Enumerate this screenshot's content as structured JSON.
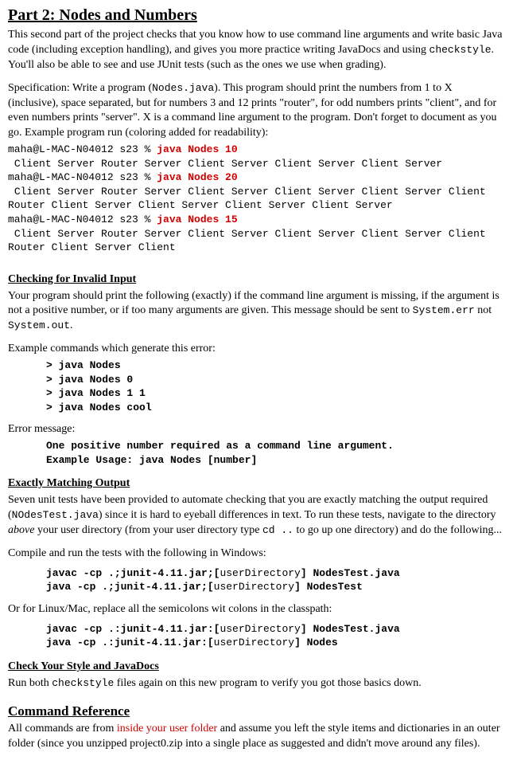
{
  "title": "Part 2: Nodes and Numbers",
  "intro": "This second part of the project checks that you know how to use command line arguments and write basic Java code (including exception handling), and gives you more practice writing JavaDocs and using ",
  "intro_mono1": "checkstyle",
  "intro_tail": ". You'll also be able to see and use JUnit tests (such as the ones we use when grading).",
  "spec_lead": "Specification: Write a program (",
  "spec_file": "Nodes.java",
  "spec_mid": "). This program should print the numbers from 1 to X (inclusive), space separated, but for numbers 3 and 12 prints \"router\", for odd numbers prints \"client\", and for even numbers prints \"server\". X is a command line argument to the program. Don't forget to document as you go. Example program run (coloring added for readability):",
  "run1_prompt": "maha@L-MAC-N04012 s23 % ",
  "run1_cmd": "java Nodes 10",
  "run1_out": " Client Server Router Server Client Server Client Server Client Server",
  "run2_prompt": "maha@L-MAC-N04012 s23 % ",
  "run2_cmd": "java Nodes 20",
  "run2_out": " Client Server Router Server Client Server Client Server Client Server Client Router Client Server Client Server Client Server Client Server",
  "run3_prompt": "maha@L-MAC-N04012 s23 % ",
  "run3_cmd": "java Nodes 15",
  "run3_out": " Client Server Router Server Client Server Client Server Client Server Client Router Client Server Client",
  "h_invalid": "Checking for Invalid Input",
  "invalid_p1a": "Your program should print the following (exactly) if the command line argument is missing, if the argument is not a positive number, or if too many arguments are given. This message should be sent to ",
  "invalid_m1": "System.err",
  "invalid_mid": " not ",
  "invalid_m2": "System.out",
  "invalid_tail": ".",
  "example_cmds_label": "Example commands which generate this error:",
  "cmd1": "> java Nodes",
  "cmd2": "> java Nodes 0",
  "cmd3": "> java Nodes 1 1",
  "cmd4": "> java Nodes cool",
  "err_label": "Error message:",
  "err_line1": "One positive number required as a command line argument.",
  "err_line2": "Example Usage: java Nodes [number]",
  "h_exact": "Exactly Matching Output",
  "exact_p1a": "Seven unit tests have been provided to automate checking that you are exactly matching the output required (",
  "exact_file": "NOdesTest.java",
  "exact_p1b": ") since it is hard to eyeball differences in text. To run these tests, navigate to the directory ",
  "exact_above": "above",
  "exact_p1c": " your user directory (from your user directory type ",
  "exact_cd": "cd ..",
  "exact_p1d": " to go up one directory) and do the following...",
  "compile_label": "Compile and run the tests with the following in Windows:",
  "win_a1": "javac -cp .;junit-4.11.jar;[",
  "win_ud": "userDirectory",
  "win_a2": "] NodesTest.java",
  "win_b1": "java -cp .;junit-4.11.jar;[",
  "win_b2": "] NodesTest",
  "linux_label": "Or for Linux/Mac, replace all the semicolons wit colons in the classpath:",
  "lin_a1": "javac -cp .:junit-4.11.jar:[",
  "lin_a2": "] NodesTest.java",
  "lin_b1": "java -cp .:junit-4.11.jar:[",
  "lin_b2": "] Nodes",
  "h_style": "Check Your Style and JavaDocs",
  "style_p1a": "Run both ",
  "style_m1": "checkstyle",
  "style_p1b": " files again on this new program to verify you got those basics down.",
  "h_cmdref": "Command Reference",
  "cmdref_a": "All commands are from ",
  "cmdref_red": "inside your user folder",
  "cmdref_b": " and assume you left the style items and dictionaries in an outer folder (since you unzipped project0.zip into a single place as suggested and didn't move around any files)."
}
